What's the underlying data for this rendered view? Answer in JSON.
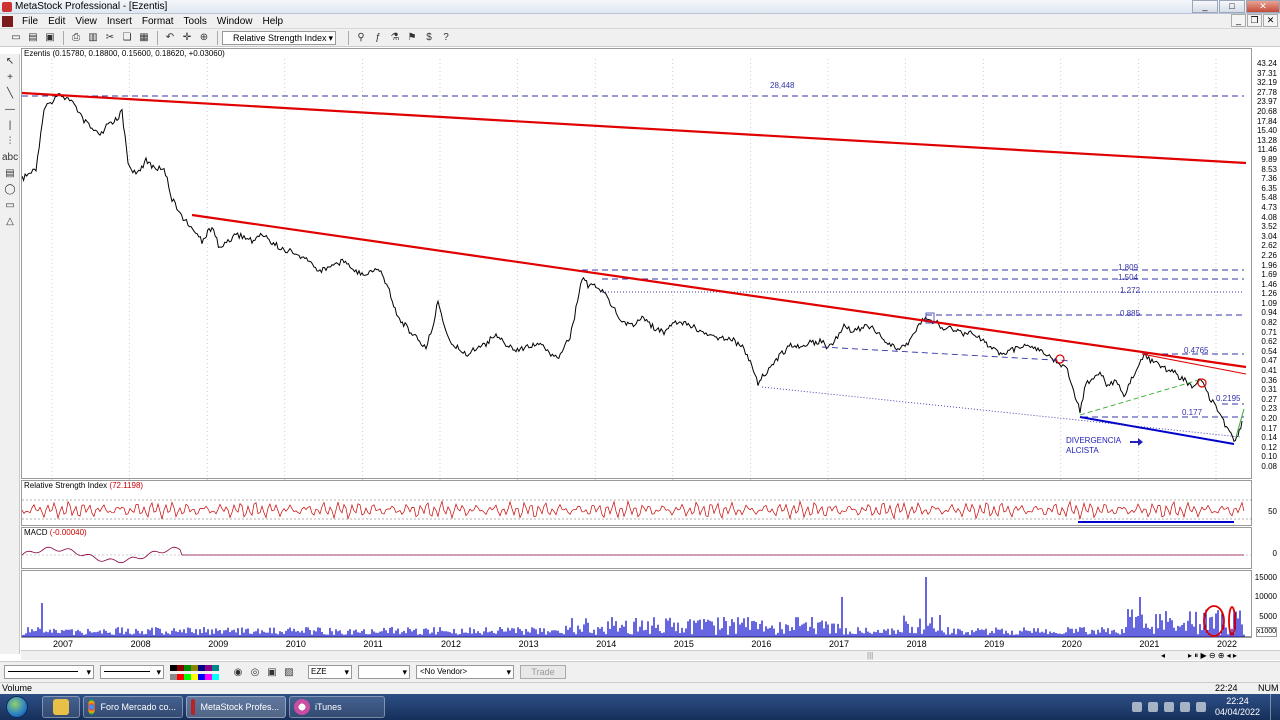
{
  "window": {
    "title": "MetaStock Professional - [Ezentis]",
    "buttons": [
      "_",
      "□",
      "✕"
    ]
  },
  "menu": [
    "File",
    "Edit",
    "View",
    "Insert",
    "Format",
    "Tools",
    "Window",
    "Help"
  ],
  "toolbar": {
    "indicator_select": "Relative Strength Index",
    "icons": [
      "new-icon",
      "open-icon",
      "save-icon",
      "print-icon",
      "print-preview-icon",
      "cut-icon",
      "copy-icon",
      "paste-icon",
      "undo-icon",
      "crosshair-icon",
      "zoom-icon",
      "explorer-icon",
      "indicator-builder-icon",
      "system-tester-icon",
      "expert-advisor-icon",
      "dollar-icon",
      "help-icon"
    ]
  },
  "left_tools": [
    "pointer-icon",
    "crosshair-icon",
    "trendline-icon",
    "horizontal-line-icon",
    "vertical-line-icon",
    "fibonacci-icon",
    "text-icon",
    "fill-icon",
    "ellipse-icon",
    "rectangle-icon",
    "triangle-icon"
  ],
  "price_pane": {
    "header_name": "Ezentis",
    "header_values": "(0.15780, 0.18800, 0.15600, 0.18620, +0.03060)",
    "y_labels": [
      "43.24",
      "37.31",
      "32.19",
      "27.78",
      "23.97",
      "20.68",
      "17.84",
      "15.40",
      "13.28",
      "11.46",
      "9.89",
      "8.53",
      "7.36",
      "6.35",
      "5.48",
      "4.73",
      "4.08",
      "3.52",
      "3.04",
      "2.62",
      "2.26",
      "1.96",
      "1.69",
      "1.46",
      "1.26",
      "1.09",
      "0.94",
      "0.82",
      "0.71",
      "0.62",
      "0.54",
      "0.47",
      "0.41",
      "0.36",
      "0.31",
      "0.27",
      "0.23",
      "0.20",
      "0.17",
      "0.14",
      "0.12",
      "0.10",
      "0.08"
    ],
    "annotations": {
      "level_1": "28,448",
      "level_2": "1.809",
      "level_3": "1.504",
      "level_4": "1.272",
      "level_5": "0.885",
      "level_6": "0.4765",
      "level_7": "0.2195",
      "level_8": "0.177",
      "divergence_line1": "DIVERGENCIA",
      "divergence_line2": "ALCISTA"
    }
  },
  "rsi_pane": {
    "header_name": "Relative Strength Index",
    "header_value": "(72.1198)",
    "y_label": "50"
  },
  "macd_pane": {
    "header_name": "MACD",
    "header_value": "(-0.00040)",
    "y_label": "0"
  },
  "volume_pane": {
    "y_labels": [
      "15000",
      "10000",
      "5000"
    ],
    "multiplier": "x1000"
  },
  "x_axis": [
    "2007",
    "2008",
    "2009",
    "2010",
    "2011",
    "2012",
    "2013",
    "2014",
    "2015",
    "2016",
    "2017",
    "2018",
    "2019",
    "2020",
    "2021",
    "2022"
  ],
  "bottom_bar": {
    "symbol": "EZE",
    "vendor": "<No Vendor>",
    "trade": "Trade"
  },
  "status": {
    "left": "Volume",
    "time": "22:24",
    "num": "NUM"
  },
  "taskbar": {
    "tasks": [
      "Foro Mercado co...",
      "MetaStock Profes...",
      "iTunes"
    ],
    "clock_time": "22:24",
    "clock_date": "04/04/2022"
  },
  "colors": {
    "price": "#000000",
    "trendline": "#e00000",
    "support": "#0000cc",
    "rsi": "#cc0000",
    "volume": "#0000cc",
    "dashed_level": "#3333aa"
  }
}
